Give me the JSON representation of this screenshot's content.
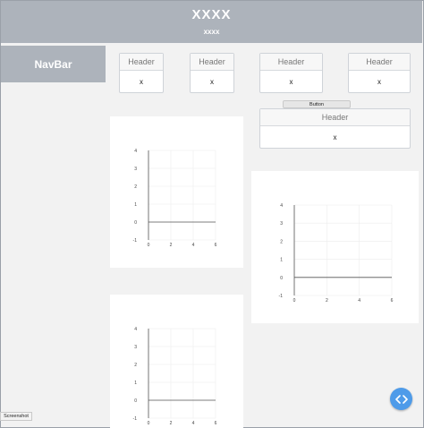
{
  "header": {
    "title": "XXXX",
    "subtitle": "xxxx"
  },
  "navbar": {
    "label": "NavBar"
  },
  "cards": [
    {
      "header": "Header",
      "value": "x"
    },
    {
      "header": "Header",
      "value": "x"
    },
    {
      "header": "Header",
      "value": "x"
    },
    {
      "header": "Header",
      "value": "x"
    },
    {
      "header": "Header",
      "value": "x"
    }
  ],
  "button": {
    "label": "Button"
  },
  "screenshot_button": {
    "label": "Screenshot"
  },
  "fab": {
    "icon": "code-icon",
    "color": "#4e9be9"
  },
  "chart_data": [
    {
      "type": "line",
      "x_ticks": [
        0,
        2,
        4,
        6
      ],
      "y_ticks": [
        -1,
        0,
        1,
        2,
        3,
        4
      ],
      "xlim": [
        0,
        6
      ],
      "ylim": [
        -1,
        4
      ],
      "grid": true,
      "series": []
    },
    {
      "type": "line",
      "x_ticks": [
        0,
        2,
        4,
        6
      ],
      "y_ticks": [
        -1,
        0,
        1,
        2,
        3,
        4
      ],
      "xlim": [
        0,
        6
      ],
      "ylim": [
        -1,
        4
      ],
      "grid": true,
      "series": []
    },
    {
      "type": "line",
      "x_ticks": [
        0,
        2,
        4,
        6
      ],
      "y_ticks": [
        -1,
        0,
        1,
        2,
        3,
        4
      ],
      "xlim": [
        0,
        6
      ],
      "ylim": [
        -1,
        4
      ],
      "grid": true,
      "series": []
    }
  ]
}
